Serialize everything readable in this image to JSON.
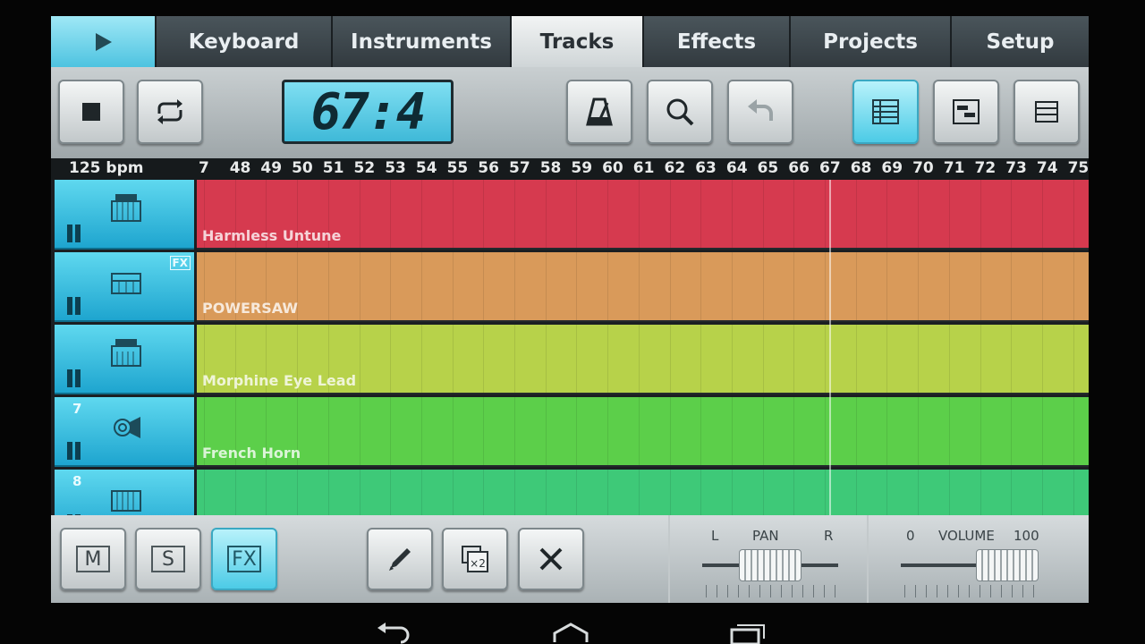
{
  "tabs": {
    "play_icon": "play-icon",
    "items": [
      {
        "label": "Keyboard",
        "active": false
      },
      {
        "label": "Instruments",
        "active": false
      },
      {
        "label": "Tracks",
        "active": true
      },
      {
        "label": "Effects",
        "active": false
      },
      {
        "label": "Projects",
        "active": false
      },
      {
        "label": "Setup",
        "active": false
      }
    ]
  },
  "toolbar": {
    "stop_icon": "stop-icon",
    "loop_icon": "loop-icon",
    "position_display": "67:4",
    "metronome_icon": "metronome-icon",
    "zoom_icon": "magnifier-icon",
    "undo_icon": "undo-icon",
    "view_tracks_icon": "track-list-icon",
    "view_piano_roll_icon": "piano-roll-icon",
    "view_menu_icon": "menu-icon"
  },
  "ruler": {
    "bpm": "125 bpm",
    "bars": [
      "7",
      "48",
      "49",
      "50",
      "51",
      "52",
      "53",
      "54",
      "55",
      "56",
      "57",
      "58",
      "59",
      "60",
      "61",
      "62",
      "63",
      "64",
      "65",
      "66",
      "67",
      "68",
      "69",
      "70",
      "71",
      "72",
      "73",
      "74",
      "75"
    ]
  },
  "tracks": [
    {
      "number": "",
      "instrument": "BASS",
      "name": "Harmless Untune",
      "color": "#d63a4f",
      "fx": false
    },
    {
      "number": "",
      "instrument": "synth",
      "name": "POWERSAW",
      "color": "#d99a5a",
      "fx": true
    },
    {
      "number": "",
      "instrument": "LEAD",
      "name": "Morphine Eye Lead",
      "color": "#b7d24a",
      "fx": false
    },
    {
      "number": "7",
      "instrument": "horn",
      "name": "French Horn",
      "color": "#5ccf4a",
      "fx": false
    },
    {
      "number": "8",
      "instrument": "keys",
      "name": "",
      "color": "#3ec978",
      "fx": false
    }
  ],
  "bottom": {
    "mute_label": "M",
    "solo_label": "S",
    "fx_label": "FX",
    "pencil_icon": "pencil-icon",
    "duplicate_label": "×2",
    "delete_icon": "delete-icon",
    "pan": {
      "label": "PAN",
      "left": "L",
      "right": "R",
      "value": 0.5
    },
    "volume": {
      "label": "VOLUME",
      "min": "0",
      "max": "100",
      "value": 0.78
    }
  },
  "nav": {
    "back_icon": "back-icon",
    "home_icon": "home-icon",
    "recents_icon": "recents-icon"
  }
}
